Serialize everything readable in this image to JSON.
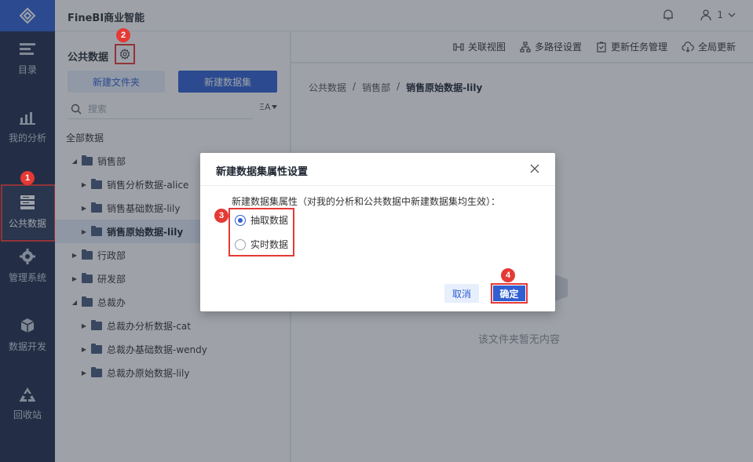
{
  "app": {
    "title": "FineBI商业智能"
  },
  "rail": {
    "items": [
      {
        "label": "目录"
      },
      {
        "label": "我的分析"
      },
      {
        "label": "公共数据"
      },
      {
        "label": "管理系统"
      },
      {
        "label": "数据开发"
      },
      {
        "label": "回收站"
      }
    ]
  },
  "header": {
    "user": "1"
  },
  "panel": {
    "title": "公共数据",
    "new_folder": "新建文件夹",
    "new_dataset": "新建数据集",
    "search_placeholder": "搜索",
    "sort_label": "ΞA",
    "tree": [
      {
        "label": "全部数据"
      },
      {
        "label": "销售部"
      },
      {
        "label": "销售分析数据-alice"
      },
      {
        "label": "销售基础数据-lily"
      },
      {
        "label": "销售原始数据-lily"
      },
      {
        "label": "行政部"
      },
      {
        "label": "研发部"
      },
      {
        "label": "总裁办"
      },
      {
        "label": "总裁办分析数据-cat"
      },
      {
        "label": "总裁办基础数据-wendy"
      },
      {
        "label": "总裁办原始数据-lily"
      }
    ]
  },
  "toolbar": {
    "relation_view": "关联视图",
    "multipath": "多路径设置",
    "update_tasks": "更新任务管理",
    "global_update": "全局更新"
  },
  "breadcrumb": {
    "a": "公共数据",
    "b": "销售部",
    "c": "销售原始数据-lily",
    "sep": "/"
  },
  "empty": {
    "text": "该文件夹暂无内容"
  },
  "dialog": {
    "title": "新建数据集属性设置",
    "description": "新建数据集属性（对我的分析和公共数据中新建数据集均生效）：",
    "option_extract": "抽取数据",
    "option_realtime": "实时数据",
    "cancel": "取消",
    "confirm": "确定"
  },
  "badges": {
    "b1": "1",
    "b2": "2",
    "b3": "3",
    "b4": "4"
  },
  "colors": {
    "accent": "#2f5fd2",
    "rail": "#1f2d4d",
    "annotation": "#e53935"
  }
}
